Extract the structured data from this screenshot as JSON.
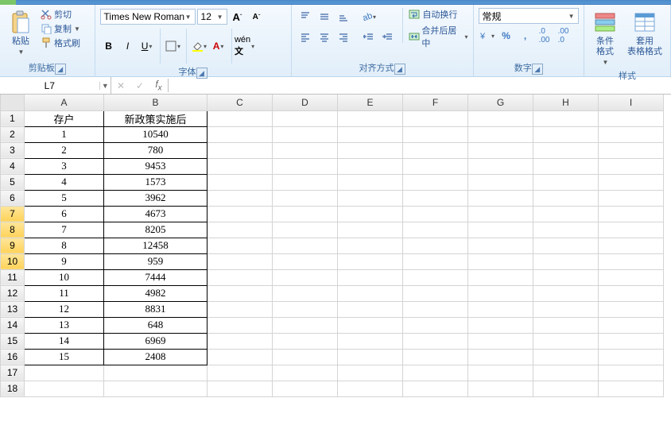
{
  "titlebar": {},
  "ribbon": {
    "clipboard": {
      "paste": "粘贴",
      "cut": "剪切",
      "copy": "复制",
      "painter": "格式刷",
      "group": "剪贴板"
    },
    "font": {
      "name": "Times New Roman",
      "size": "12",
      "group": "字体"
    },
    "alignment": {
      "wrap": "自动换行",
      "merge": "合并后居中",
      "group": "对齐方式"
    },
    "number": {
      "format": "常规",
      "group": "数字"
    },
    "styles": {
      "cond": "条件格式",
      "table": "套用\n表格格式",
      "group": "样式"
    }
  },
  "namebox": {
    "ref": "L7"
  },
  "formula": {
    "value": ""
  },
  "columns": [
    "A",
    "B",
    "C",
    "D",
    "E",
    "F",
    "G",
    "H",
    "I"
  ],
  "rows": [
    1,
    2,
    3,
    4,
    5,
    6,
    7,
    8,
    9,
    10,
    11,
    12,
    13,
    14,
    15,
    16,
    17,
    18
  ],
  "highlight_rows": [
    7,
    8,
    9,
    10
  ],
  "data": {
    "header": [
      "存户",
      "新政策实施后"
    ],
    "rows": [
      [
        "1",
        "10540"
      ],
      [
        "2",
        "780"
      ],
      [
        "3",
        "9453"
      ],
      [
        "4",
        "1573"
      ],
      [
        "5",
        "3962"
      ],
      [
        "6",
        "4673"
      ],
      [
        "7",
        "8205"
      ],
      [
        "8",
        "12458"
      ],
      [
        "9",
        "959"
      ],
      [
        "10",
        "7444"
      ],
      [
        "11",
        "4982"
      ],
      [
        "12",
        "8831"
      ],
      [
        "13",
        "648"
      ],
      [
        "14",
        "6969"
      ],
      [
        "15",
        "2408"
      ]
    ]
  }
}
